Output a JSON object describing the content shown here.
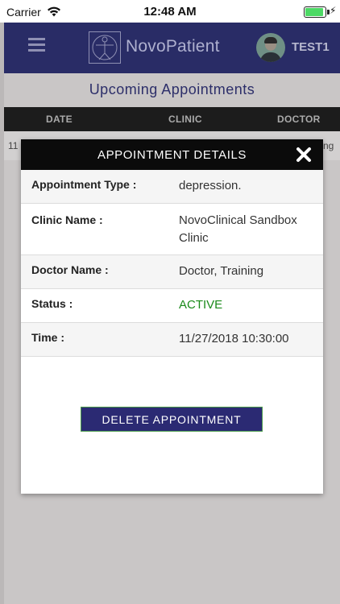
{
  "status_bar": {
    "carrier": "Carrier",
    "time": "12:48 AM",
    "icons": [
      "wifi-icon",
      "battery-icon",
      "charging-bolt-icon"
    ]
  },
  "header": {
    "brand": "NovoPatient",
    "user": "TEST1",
    "bg_color": "#292c66"
  },
  "page": {
    "title": "Upcoming Appointments",
    "columns": [
      "DATE",
      "CLINIC",
      "DOCTOR"
    ],
    "row_partial_left": "11",
    "row_partial_right": "ng"
  },
  "modal": {
    "title": "APPOINTMENT DETAILS",
    "rows": [
      {
        "label": "Appointment Type :",
        "value": "depression."
      },
      {
        "label": "Clinic Name :",
        "value": "NovoClinical Sandbox Clinic"
      },
      {
        "label": "Doctor Name :",
        "value": "Doctor, Training"
      },
      {
        "label": "Status :",
        "value": "ACTIVE",
        "value_color": "#1a8a1a"
      },
      {
        "label": "Time :",
        "value": "11/27/2018 10:30:00"
      }
    ],
    "delete_label": "DELETE APPOINTMENT",
    "delete_color": "#2b2a73"
  }
}
